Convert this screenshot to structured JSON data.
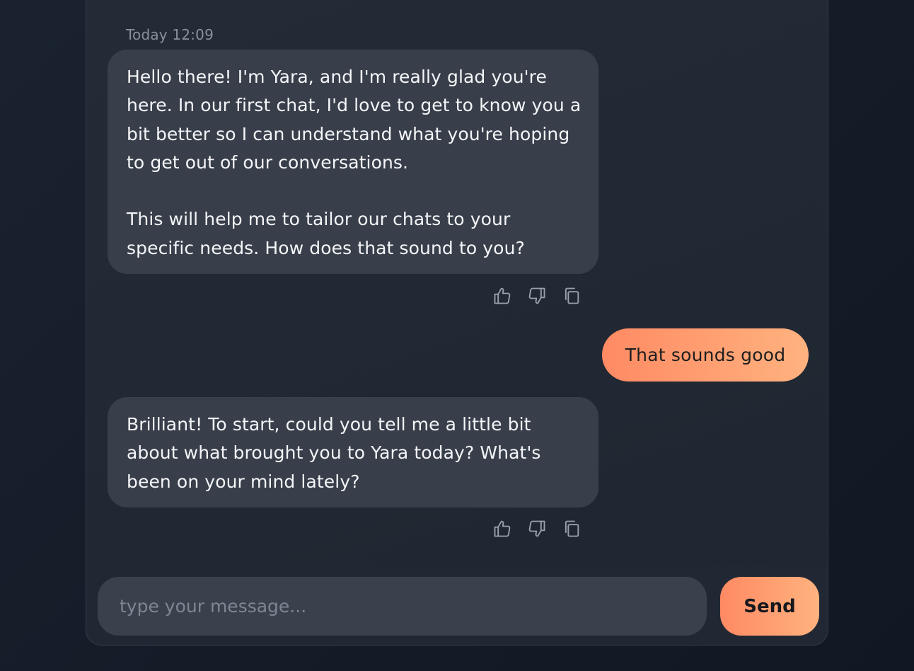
{
  "chat": {
    "timestamp": "Today 12:09",
    "messages": [
      {
        "sender": "bot",
        "text": "Hello there! I'm Yara, and I'm really glad you're here. In our first chat, I'd love to get to know you a bit better so I can understand what you're hoping to get out of our conversations.\n\nThis will help me to tailor our chats to your specific needs. How does that sound to you?",
        "actions": [
          "thumbs-up-icon",
          "thumbs-down-icon",
          "copy-icon"
        ]
      },
      {
        "sender": "user",
        "text": "That sounds good"
      },
      {
        "sender": "bot",
        "text": "Brilliant! To start, could you tell me a little bit about what brought you to Yara today? What's been on your mind lately?",
        "actions": [
          "thumbs-up-icon",
          "thumbs-down-icon",
          "copy-icon"
        ]
      }
    ]
  },
  "composer": {
    "placeholder": "type your message...",
    "value": "",
    "send_label": "Send"
  },
  "colors": {
    "bot_bubble": "#383f4b",
    "user_bubble_start": "#ff8a63",
    "user_bubble_end": "#ffb27f",
    "panel": "#222833"
  }
}
